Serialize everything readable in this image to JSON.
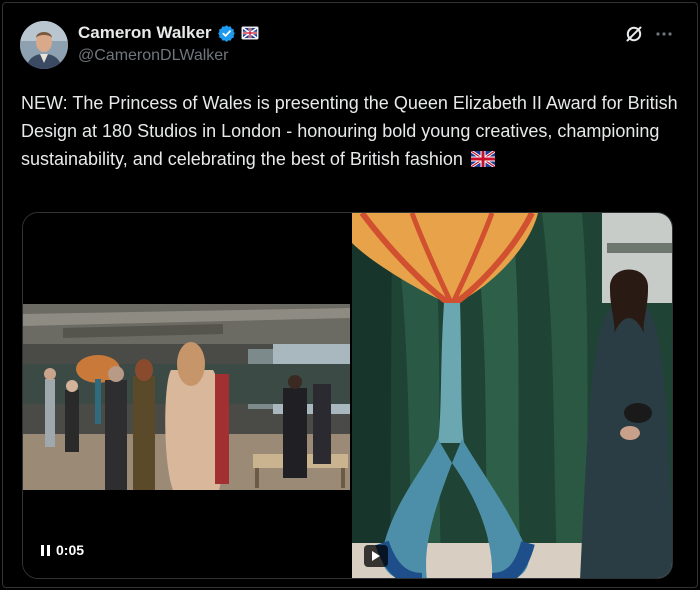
{
  "author": {
    "name": "Cameron Walker",
    "handle": "@CameronDLWalker",
    "avatar_icon": "avatar-photo-icon",
    "verified_icon": "verified-badge-icon",
    "affiliate_icon": "affiliate-badge-icon"
  },
  "header_actions": {
    "grok_icon": "grok-icon",
    "more_icon": "more-options-icon"
  },
  "tweet": {
    "text": "NEW: The Princess of Wales is presenting the Queen Elizabeth II Award for British Design at 180 Studios in London - honouring bold young creatives, championing sustainability, and celebrating the best of British fashion",
    "emoji": "union-jack-flag-icon"
  },
  "media": {
    "left_video": {
      "time": "0:05",
      "state": "playing"
    },
    "right_video": {
      "state": "paused"
    }
  },
  "colors": {
    "background": "#000000",
    "text": "#e7e9ea",
    "muted": "#71767b",
    "verified": "#1d9bf0",
    "border": "#2f3336"
  }
}
